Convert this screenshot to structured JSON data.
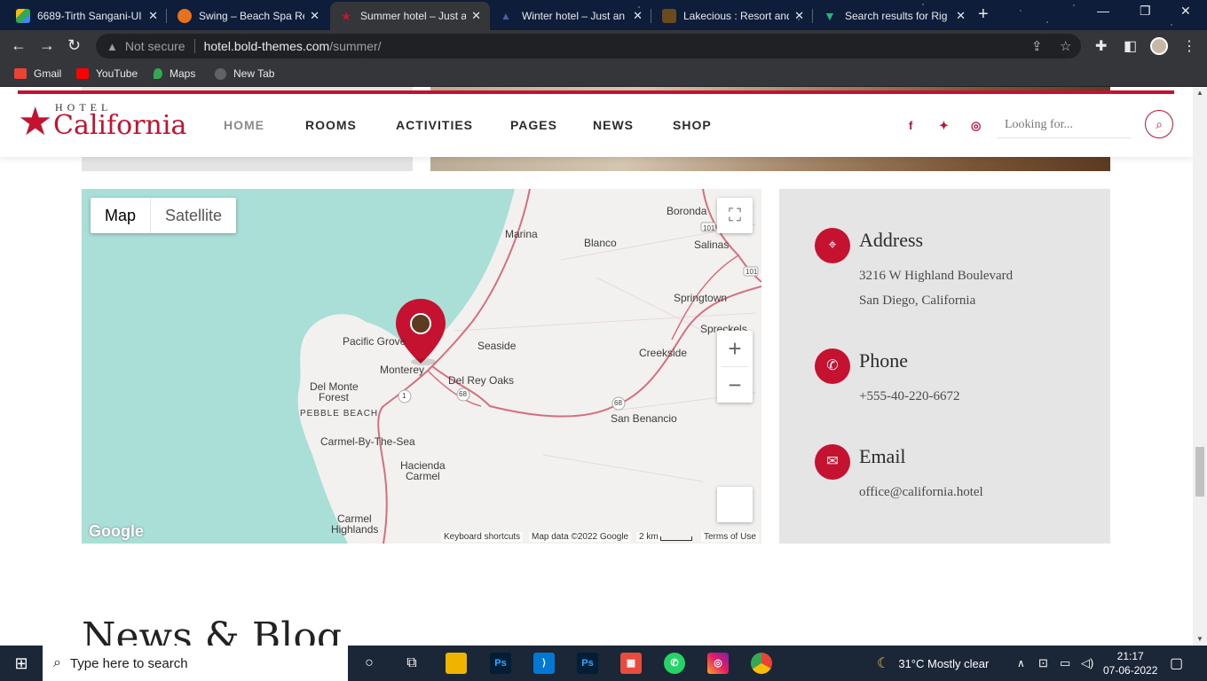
{
  "browser": {
    "tabs": [
      {
        "title": "6689-Tirth Sangani-UI",
        "favicon_color": "#4285f4",
        "active": false
      },
      {
        "title": "Swing – Beach Spa Re",
        "favicon_color": "#e8711c",
        "active": false
      },
      {
        "title": "Summer hotel – Just a",
        "favicon_color": "#c41230",
        "active": true
      },
      {
        "title": "Winter hotel – Just an",
        "favicon_color": "#4a5fa8",
        "active": false
      },
      {
        "title": "Lakecious : Resort and",
        "favicon_color": "#b07a2a",
        "active": false
      },
      {
        "title": "Search results for Rig",
        "favicon_color": "#22b573",
        "active": false
      }
    ],
    "close_glyph": "✕",
    "new_tab_glyph": "+",
    "url_security": "Not secure",
    "url_host": "hotel.bold-themes.com",
    "url_path": "/summer/",
    "bookmarks": [
      {
        "label": "Gmail",
        "color": "#ea4335"
      },
      {
        "label": "YouTube",
        "color": "#ff0000"
      },
      {
        "label": "Maps",
        "color": "#34a853"
      },
      {
        "label": "New Tab",
        "color": "#5f6368"
      }
    ]
  },
  "site": {
    "logo_small": "HOTEL",
    "logo_big": "California",
    "nav": [
      "HOME",
      "ROOMS",
      "ACTIVITIES",
      "PAGES",
      "NEWS",
      "SHOP"
    ],
    "search_placeholder": "Looking for...",
    "social_icons": [
      "facebook-icon",
      "twitter-icon",
      "instagram-icon"
    ],
    "brand_color": "#c41230"
  },
  "map": {
    "type_buttons": [
      "Map",
      "Satellite"
    ],
    "places": [
      {
        "label": "Boronda",
        "caps": false
      },
      {
        "label": "Marina",
        "caps": false
      },
      {
        "label": "Blanco",
        "caps": false
      },
      {
        "label": "Salinas",
        "caps": false
      },
      {
        "label": "Springtown",
        "caps": false
      },
      {
        "label": "Spreckels",
        "caps": false
      },
      {
        "label": "Pacific Grove",
        "caps": false
      },
      {
        "label": "Seaside",
        "caps": false
      },
      {
        "label": "Monterey",
        "caps": false
      },
      {
        "label": "Creekside",
        "caps": false
      },
      {
        "label": "Del Rey Oaks",
        "caps": false
      },
      {
        "label": "Del Monte",
        "caps": false
      },
      {
        "label": "Forest",
        "caps": false
      },
      {
        "label": "PEBBLE BEACH",
        "caps": true
      },
      {
        "label": "San Benancio",
        "caps": false
      },
      {
        "label": "Carmel-By-The-Sea",
        "caps": false
      },
      {
        "label": "Hacienda",
        "caps": false
      },
      {
        "label": "Carmel",
        "caps": false
      },
      {
        "label": "Carmel",
        "caps": false
      },
      {
        "label": "Highlands",
        "caps": false
      }
    ],
    "road_shields": [
      "101",
      "101",
      "1",
      "68",
      "68"
    ],
    "logo": "Google",
    "footer": {
      "shortcuts": "Keyboard shortcuts",
      "data": "Map data ©2022 Google",
      "scale": "2 km",
      "terms": "Terms of Use"
    },
    "zoom_in": "+",
    "zoom_out": "−"
  },
  "contact": {
    "address_heading": "Address",
    "address_line1": "3216 W Highland Boulevard",
    "address_line2": "San Diego, California",
    "phone_heading": "Phone",
    "phone": "+555-40-220-6672",
    "email_heading": "Email",
    "email": "office@california.hotel"
  },
  "section_title": "News & Blog",
  "taskbar": {
    "search_placeholder": "Type here to search",
    "weather": "31°C  Mostly clear",
    "time": "21:17",
    "date": "07-06-2022"
  }
}
